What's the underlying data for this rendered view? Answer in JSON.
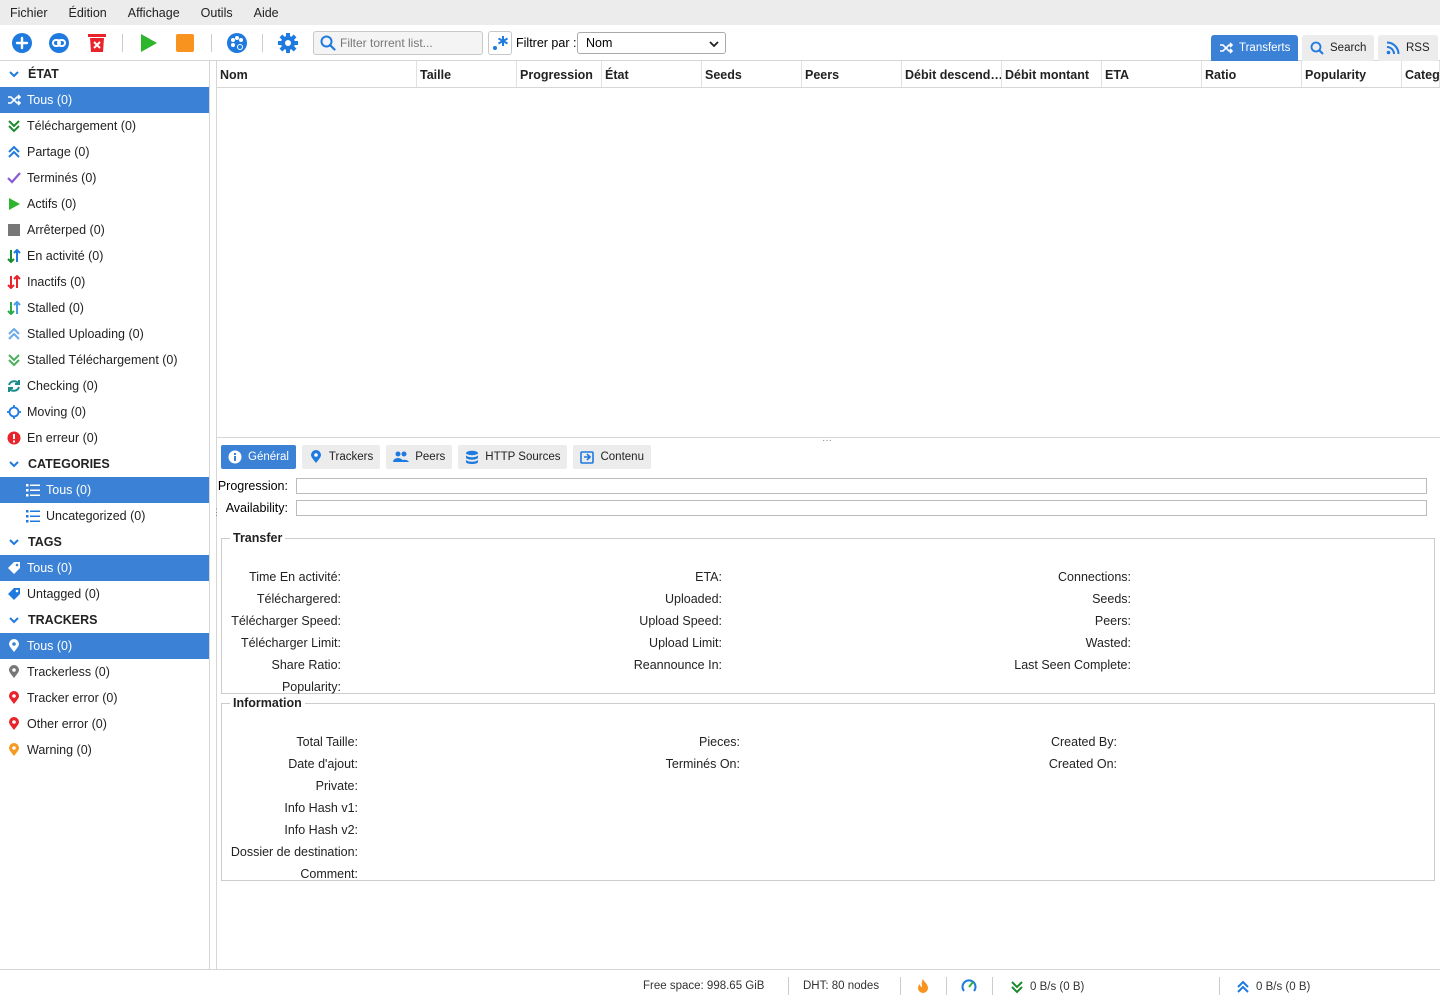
{
  "menu": [
    "Fichier",
    "Édition",
    "Affichage",
    "Outils",
    "Aide"
  ],
  "toolbar": {
    "search_placeholder": "Filter torrent list...",
    "filter_label": "Filtrer par :",
    "filter_value": "Nom",
    "view_tabs": [
      {
        "label": "Transferts",
        "icon": "shuffle-icon",
        "active": true
      },
      {
        "label": "Search",
        "icon": "search-icon",
        "active": false
      },
      {
        "label": "RSS",
        "icon": "rss-icon",
        "active": false
      }
    ]
  },
  "sidebar": {
    "status_header": "ÉTAT",
    "status_items": [
      {
        "label": "Tous (0)",
        "icon": "shuffle-icon",
        "selected": true
      },
      {
        "label": "Téléchargement (0)",
        "icon": "download-icon"
      },
      {
        "label": "Partage (0)",
        "icon": "upload-icon"
      },
      {
        "label": "Terminés (0)",
        "icon": "check-icon"
      },
      {
        "label": "Actifs (0)",
        "icon": "play-icon"
      },
      {
        "label": "Arrêterped (0)",
        "icon": "stop-icon"
      },
      {
        "label": "En activité (0)",
        "icon": "active-arrows-icon"
      },
      {
        "label": "Inactifs (0)",
        "icon": "inactive-arrows-icon"
      },
      {
        "label": "Stalled (0)",
        "icon": "stalled-arrows-icon"
      },
      {
        "label": "Stalled Uploading (0)",
        "icon": "stalled-upload-icon"
      },
      {
        "label": "Stalled Téléchargement (0)",
        "icon": "stalled-download-icon"
      },
      {
        "label": "Checking (0)",
        "icon": "refresh-icon"
      },
      {
        "label": "Moving (0)",
        "icon": "move-icon"
      },
      {
        "label": "En erreur (0)",
        "icon": "error-icon"
      }
    ],
    "categories_header": "CATEGORIES",
    "category_items": [
      {
        "label": "Tous (0)",
        "selected": true
      },
      {
        "label": "Uncategorized (0)"
      }
    ],
    "tags_header": "TAGS",
    "tag_items": [
      {
        "label": "Tous (0)",
        "selected": true
      },
      {
        "label": "Untagged (0)"
      }
    ],
    "trackers_header": "TRACKERS",
    "tracker_items": [
      {
        "label": "Tous (0)",
        "selected": true,
        "color": "#ffffff"
      },
      {
        "label": "Trackerless (0)",
        "color": "#777777"
      },
      {
        "label": "Tracker error (0)",
        "color": "#e8232b"
      },
      {
        "label": "Other error (0)",
        "color": "#e8232b"
      },
      {
        "label": "Warning (0)",
        "color": "#f59a23"
      }
    ]
  },
  "table": {
    "columns": [
      "Nom",
      "Taille",
      "Progression",
      "État",
      "Seeds",
      "Peers",
      "Débit descend…",
      "Débit montant",
      "ETA",
      "Ratio",
      "Popularity",
      "Category"
    ]
  },
  "props": {
    "tabs": [
      "Général",
      "Trackers",
      "Peers",
      "HTTP Sources",
      "Contenu"
    ],
    "progress_label": "Progression:",
    "availability_label": "Availability:",
    "transfer_title": "Transfer",
    "transfer_col1": [
      "Time En activité:",
      "Téléchargered:",
      "Télécharger Speed:",
      "Télécharger Limit:",
      "Share Ratio:",
      "Popularity:"
    ],
    "transfer_col2": [
      "ETA:",
      "Uploaded:",
      "Upload Speed:",
      "Upload Limit:",
      "Reannounce In:"
    ],
    "transfer_col3": [
      "Connections:",
      "Seeds:",
      "Peers:",
      "Wasted:",
      "Last Seen Complete:"
    ],
    "info_title": "Information",
    "info_col1": [
      "Total Taille:",
      "Date d'ajout:",
      "Private:",
      "Info Hash v1:",
      "Info Hash v2:",
      "Dossier de destination:",
      "Comment:"
    ],
    "info_col2": [
      "Pieces:",
      "Terminés On:"
    ],
    "info_col3": [
      "Created By:",
      "Created On:"
    ]
  },
  "status": {
    "free_space": "Free space: 998.65 GiB",
    "dht": "DHT: 80 nodes",
    "download": "0 B/s (0 B)",
    "upload": "0 B/s (0 B)"
  },
  "colors": {
    "accent": "#3b82d6",
    "play": "#2db52d",
    "stop": "#f7931e",
    "remove": "#e8232b"
  }
}
